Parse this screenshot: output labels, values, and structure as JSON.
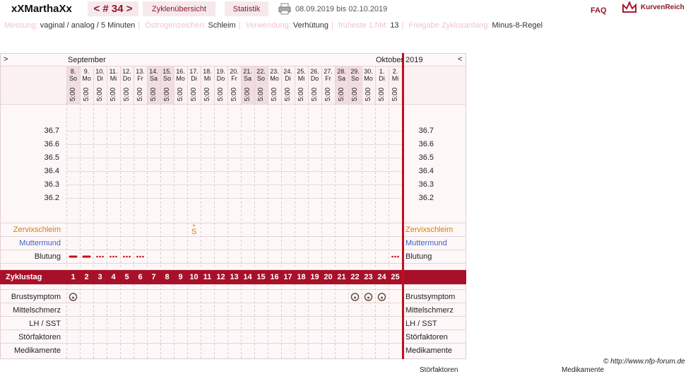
{
  "header": {
    "user": "xXMarthaXx",
    "cycle": "< # 34 >",
    "nav_overview": "Zyklenübersicht",
    "nav_stats": "Statistik",
    "date_range": "08.09.2019 bis 02.10.2019",
    "faq": "FAQ",
    "brand": "KurvenReich"
  },
  "info": {
    "measurement_label": "Messung:",
    "measurement": "vaginal / analog / 5 Minuten",
    "estrogen_label": "Östrogenzeichen:",
    "estrogen": "Schleim",
    "usage_label": "Verwendung:",
    "usage": "Verhütung",
    "earliest_label": "früheste 1.hM:",
    "earliest": "13",
    "release_label": "Freigabe Zyklusanfang:",
    "release": "Minus-8-Regel"
  },
  "chart": {
    "nav_left": ">",
    "nav_right": "<",
    "month_start": "September",
    "month_end": "Oktober",
    "year": "2019",
    "days": [
      {
        "d": "8.",
        "w": "So",
        "t": "5:00",
        "we": true
      },
      {
        "d": "9.",
        "w": "Mo",
        "t": "5:00",
        "we": false
      },
      {
        "d": "10.",
        "w": "Di",
        "t": "5:00",
        "we": false
      },
      {
        "d": "11.",
        "w": "Mi",
        "t": "5:00",
        "we": false
      },
      {
        "d": "12.",
        "w": "Do",
        "t": "5:00",
        "we": false
      },
      {
        "d": "13.",
        "w": "Fr",
        "t": "5:00",
        "we": false
      },
      {
        "d": "14.",
        "w": "Sa",
        "t": "5:00",
        "we": true
      },
      {
        "d": "15.",
        "w": "So",
        "t": "5:00",
        "we": true
      },
      {
        "d": "16.",
        "w": "Mo",
        "t": "5:00",
        "we": false
      },
      {
        "d": "17.",
        "w": "Di",
        "t": "5:00",
        "we": false
      },
      {
        "d": "18.",
        "w": "Mi",
        "t": "5:00",
        "we": false
      },
      {
        "d": "19.",
        "w": "Do",
        "t": "5:00",
        "we": false
      },
      {
        "d": "20.",
        "w": "Fr",
        "t": "5:00",
        "we": false
      },
      {
        "d": "21.",
        "w": "Sa",
        "t": "5:00",
        "we": true
      },
      {
        "d": "22.",
        "w": "So",
        "t": "5:00",
        "we": true
      },
      {
        "d": "23.",
        "w": "Mo",
        "t": "5:00",
        "we": false
      },
      {
        "d": "24.",
        "w": "Di",
        "t": "5:00",
        "we": false
      },
      {
        "d": "25.",
        "w": "Mi",
        "t": "5:00",
        "we": false
      },
      {
        "d": "26.",
        "w": "Do",
        "t": "5:00",
        "we": false
      },
      {
        "d": "27.",
        "w": "Fr",
        "t": "5:00",
        "we": false
      },
      {
        "d": "28.",
        "w": "Sa",
        "t": "5:00",
        "we": true
      },
      {
        "d": "29.",
        "w": "So",
        "t": "5:00",
        "we": true
      },
      {
        "d": "30.",
        "w": "Mo",
        "t": "5:00",
        "we": false
      },
      {
        "d": "1.",
        "w": "Di",
        "t": "5:00",
        "we": false
      },
      {
        "d": "2.",
        "w": "Mi",
        "t": "5:00",
        "we": false
      }
    ],
    "temps": [
      "36.7",
      "36.6",
      "36.5",
      "36.4",
      "36.3",
      "36.2"
    ],
    "row_cervix": "Zervixschleim",
    "row_os": "Muttermund",
    "row_bleeding": "Blutung",
    "row_cycleday": "Zyklustag",
    "row_breast": "Brustsymptom",
    "row_midpain": "Mittelschmerz",
    "row_lh": "LH / SST",
    "row_disturb": "Störfaktoren",
    "row_meds": "Medikamente",
    "cervix_mark": {
      "day": 9,
      "top": "+",
      "bottom": "S"
    },
    "bleeding": [
      {
        "day": 0,
        "type": "heavy"
      },
      {
        "day": 1,
        "type": "heavy"
      },
      {
        "day": 2,
        "type": "dots"
      },
      {
        "day": 3,
        "type": "dots"
      },
      {
        "day": 4,
        "type": "dots"
      },
      {
        "day": 5,
        "type": "dots"
      },
      {
        "day": 24,
        "type": "dots"
      }
    ],
    "breast": [
      0,
      21,
      22,
      23
    ]
  },
  "footer": {
    "credit": "© http://www.nfp-forum.de",
    "cut_left": "Störfaktoren",
    "cut_right": "Medikamente"
  }
}
